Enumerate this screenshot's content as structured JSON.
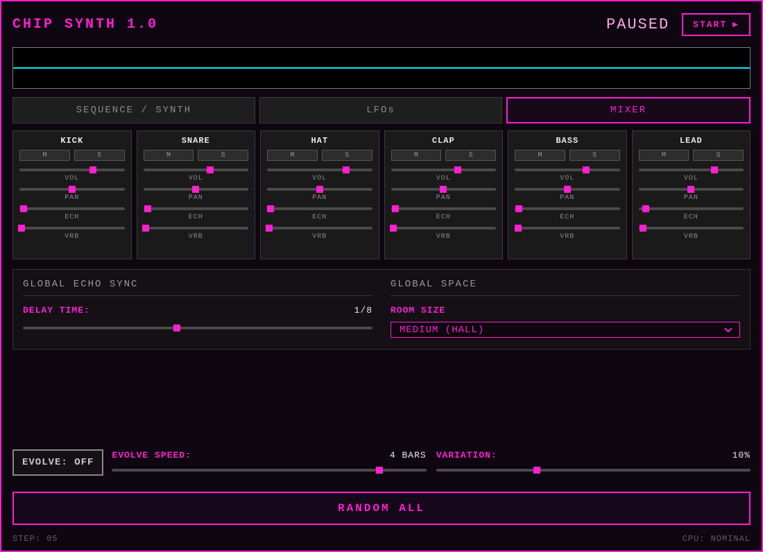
{
  "colors": {
    "accent": "#ff1fd0",
    "accent-light": "#ffa9e2",
    "cyan": "#00e8ff"
  },
  "header": {
    "title": "CHIP SYNTH 1.0",
    "status": "PAUSED",
    "start_label": "START",
    "play_icon": "▶"
  },
  "tabs": {
    "active_index": 2,
    "items": [
      {
        "label": "SEQUENCE / SYNTH"
      },
      {
        "label": "LFOs"
      },
      {
        "label": "MIXER"
      }
    ]
  },
  "mixer": {
    "mute_label": "M",
    "solo_label": "S",
    "slider_labels": [
      "VOL",
      "PAN",
      "ECH",
      "VRB"
    ],
    "channels": [
      {
        "name": "KICK",
        "vol": 0.7,
        "pan": 0.5,
        "ech": 0.04,
        "vrb": 0.02
      },
      {
        "name": "SNARE",
        "vol": 0.64,
        "pan": 0.5,
        "ech": 0.04,
        "vrb": 0.02
      },
      {
        "name": "HAT",
        "vol": 0.75,
        "pan": 0.5,
        "ech": 0.03,
        "vrb": 0.02
      },
      {
        "name": "CLAP",
        "vol": 0.64,
        "pan": 0.5,
        "ech": 0.04,
        "vrb": 0.02
      },
      {
        "name": "BASS",
        "vol": 0.68,
        "pan": 0.5,
        "ech": 0.04,
        "vrb": 0.03
      },
      {
        "name": "LEAD",
        "vol": 0.72,
        "pan": 0.5,
        "ech": 0.07,
        "vrb": 0.04
      }
    ]
  },
  "global_echo": {
    "title": "GLOBAL ECHO SYNC",
    "delay_label": "DELAY TIME:",
    "delay_value": "1/8",
    "delay_slider": 0.44
  },
  "global_space": {
    "title": "GLOBAL SPACE",
    "room_label": "ROOM SIZE",
    "room_value": "MEDIUM (HALL)"
  },
  "evolve": {
    "button_label": "EVOLVE: OFF",
    "speed_label": "EVOLVE SPEED:",
    "speed_value": "4 BARS",
    "speed_slider": 0.85,
    "variation_label": "VARIATION:",
    "variation_value": "10%",
    "variation_slider": 0.32
  },
  "random_button": "RANDOM ALL",
  "footer": {
    "step": "STEP: 05",
    "cpu": "CPU: NOMINAL"
  }
}
